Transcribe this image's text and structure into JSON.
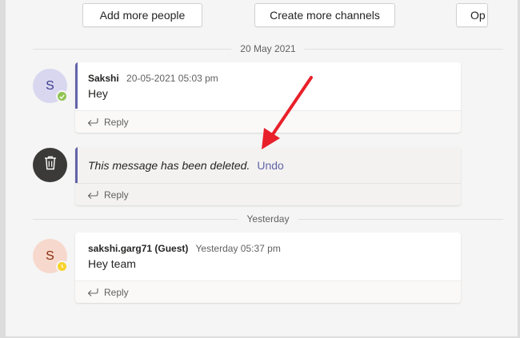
{
  "toolbar": {
    "add_people_label": "Add more people",
    "create_channels_label": "Create more channels",
    "open_label": "Op"
  },
  "dividers": {
    "first": "20 May 2021",
    "second": "Yesterday"
  },
  "messages": [
    {
      "avatar_initial": "S",
      "presence": "available",
      "author": "Sakshi",
      "timestamp": "20-05-2021 05:03 pm",
      "text": "Hey",
      "reply_label": "Reply"
    },
    {
      "deleted_text": "This message has been deleted.",
      "undo_label": "Undo",
      "avatar_icon": "trash-icon",
      "reply_label": "Reply"
    },
    {
      "avatar_initial": "S",
      "presence": "away",
      "author": "sakshi.garg71 (Guest)",
      "timestamp": "Yesterday 05:37 pm",
      "text": "Hey team",
      "reply_label": "Reply"
    }
  ],
  "colors": {
    "accent": "#6264a7",
    "annotation_arrow": "#e8202a",
    "available": "#92c353",
    "away": "#f8d22a"
  }
}
